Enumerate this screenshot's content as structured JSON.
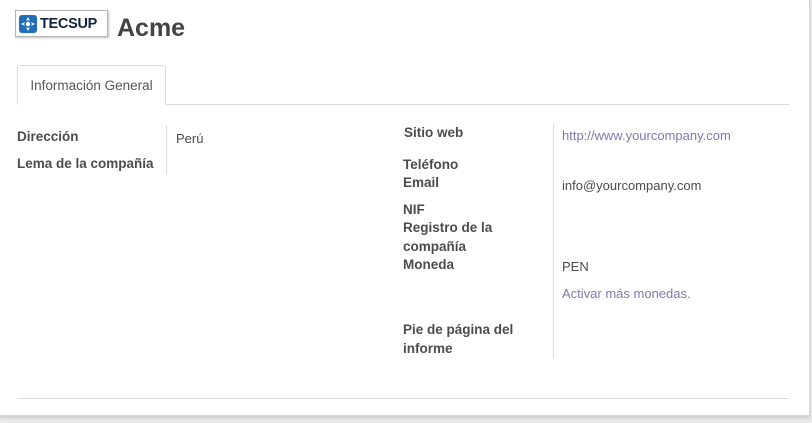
{
  "header": {
    "logo_text": "TECSUP",
    "company_name": "Acme"
  },
  "tabs": [
    {
      "label": "Información General",
      "active": true
    }
  ],
  "left_fields": {
    "address_label": "Dirección",
    "address_value": "Perú",
    "slogan_label": "Lema de la compañía"
  },
  "right_fields": {
    "website_label": "Sitio web",
    "website_value": "http://www.yourcompany.com",
    "phone_label": "Teléfono",
    "email_label": "Email",
    "email_value": "info@yourcompany.com",
    "vat_label": "NIF",
    "company_registry_label": "Registro de la compañía",
    "currency_label": "Moneda",
    "currency_value": "PEN",
    "currency_link": "Activar más monedas.",
    "report_footer_label": "Pie de página del informe"
  },
  "colors": {
    "link": "#7c7bad",
    "logo_mark": "#1e6fb8",
    "text": "#4c4c4c"
  }
}
